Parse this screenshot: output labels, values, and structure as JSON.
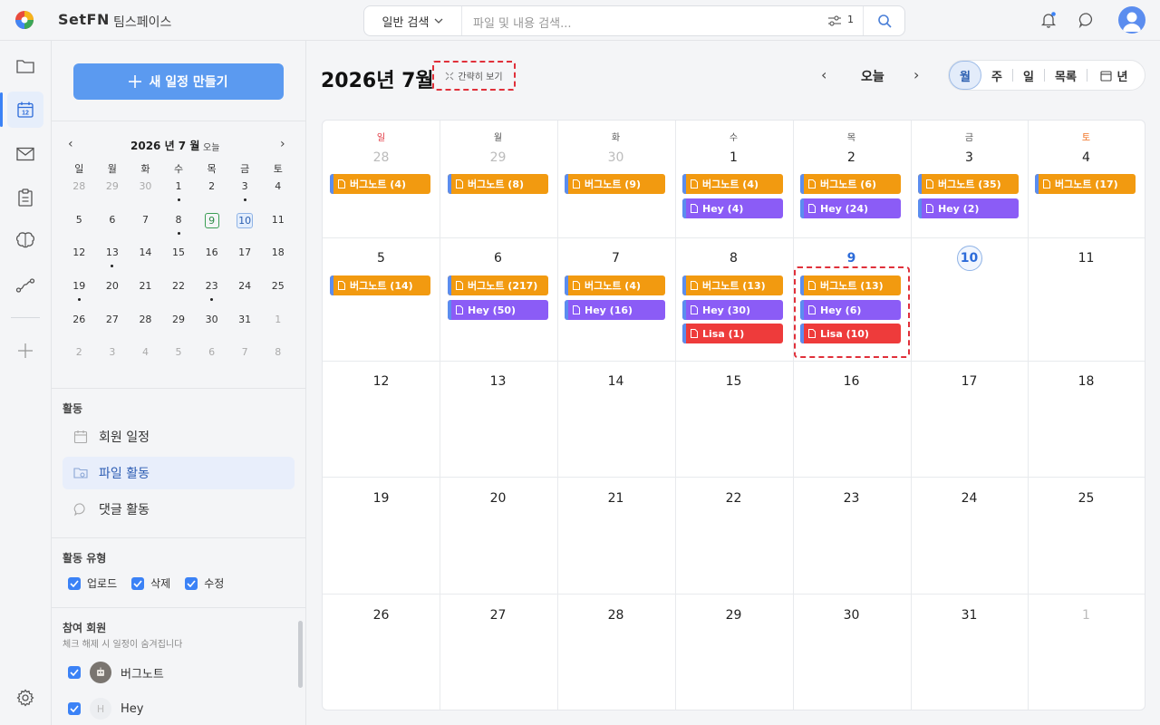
{
  "app": {
    "brand": "SetFN",
    "workspace": "팀스페이스"
  },
  "search": {
    "mode": "일반 검색",
    "placeholder": "파일 및 내용 검색...",
    "filter_count": "1"
  },
  "sidebar": {
    "new_event_label": "새 일정 만들기",
    "mini_calendar": {
      "title": "2026 년 7 월",
      "today_label": "오늘",
      "weekdays": [
        "일",
        "월",
        "화",
        "수",
        "목",
        "금",
        "토"
      ],
      "weeks": [
        [
          "28",
          "29",
          "30",
          "1",
          "2",
          "3",
          "4"
        ],
        [
          "5",
          "6",
          "7",
          "8",
          "9",
          "10",
          "11"
        ],
        [
          "12",
          "13",
          "14",
          "15",
          "16",
          "17",
          "18"
        ],
        [
          "19",
          "20",
          "21",
          "22",
          "23",
          "24",
          "25"
        ],
        [
          "26",
          "27",
          "28",
          "29",
          "30",
          "31",
          "1"
        ],
        [
          "2",
          "3",
          "4",
          "5",
          "6",
          "7",
          "8"
        ]
      ]
    },
    "activity_title": "활동",
    "activity_items": [
      "회원 일정",
      "파일 활동",
      "댓글 활동"
    ],
    "type_title": "활동 유형",
    "types": [
      "업로드",
      "삭제",
      "수정"
    ],
    "members_title": "참여 회원",
    "members_sub": "체크 해제 시 일정이 숨겨집니다",
    "members": [
      {
        "name": "버그노트",
        "initial": ""
      },
      {
        "name": "Hey",
        "initial": "H"
      }
    ]
  },
  "main": {
    "month_title": "2026년 7월",
    "brief_label": "간략히 보기",
    "today_button": "오늘",
    "views": [
      "월",
      "주",
      "일",
      "목록",
      "년"
    ],
    "weekdays": [
      "일",
      "월",
      "화",
      "수",
      "목",
      "금",
      "토"
    ],
    "days": [
      [
        "28",
        "29",
        "30",
        "1",
        "2",
        "3",
        "4"
      ],
      [
        "5",
        "6",
        "7",
        "8",
        "9",
        "10",
        "11"
      ],
      [
        "12",
        "13",
        "14",
        "15",
        "16",
        "17",
        "18"
      ],
      [
        "19",
        "20",
        "21",
        "22",
        "23",
        "24",
        "25"
      ],
      [
        "26",
        "27",
        "28",
        "29",
        "30",
        "31",
        "1"
      ]
    ],
    "events": {
      "r0c0": [
        "버그노트 (4)"
      ],
      "r0c1": [
        "버그노트 (8)"
      ],
      "r0c2": [
        "버그노트 (9)"
      ],
      "r0c3": [
        "버그노트 (4)",
        "Hey (4)"
      ],
      "r0c4": [
        "버그노트 (6)",
        "Hey (24)"
      ],
      "r0c5": [
        "버그노트 (35)",
        "Hey (2)"
      ],
      "r0c6": [
        "버그노트 (17)"
      ],
      "r1c0": [
        "버그노트 (14)"
      ],
      "r1c1": [
        "버그노트 (217)",
        "Hey (50)"
      ],
      "r1c2": [
        "버그노트 (4)",
        "Hey (16)"
      ],
      "r1c3": [
        "버그노트 (13)",
        "Hey (30)",
        "Lisa (1)"
      ],
      "r1c4": [
        "버그노트 (13)",
        "Hey (6)",
        "Lisa (10)"
      ]
    }
  },
  "colors": {
    "accent": "#3b82f6",
    "event_bugnote": "#f29a10",
    "event_hey": "#8b5cf6",
    "event_lisa": "#ee3b3b",
    "sunday": "#e0303a",
    "saturday": "#f07020"
  }
}
